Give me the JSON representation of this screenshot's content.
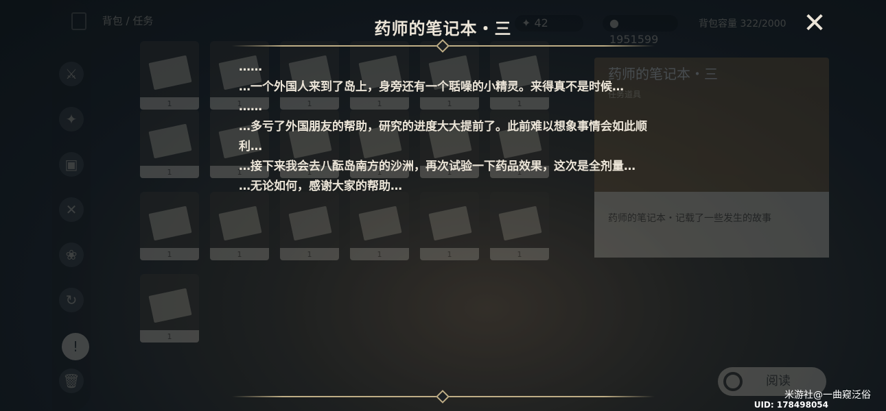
{
  "background": {
    "breadcrumb": "背包 / 任务",
    "primogems": "42",
    "mora": "1951599",
    "capacity": "背包容量 322/2000",
    "item_count": "1",
    "detail_title": "药师的笔记本・三",
    "detail_type": "任务道具",
    "detail_desc": "药师的笔记本・记载了一些发生的故事",
    "read_button": "阅读"
  },
  "note": {
    "title": "药师的笔记本・三",
    "lines": [
      "……",
      "…一个外国人来到了岛上，身旁还有一个聒噪的小精灵。来得真不是时候…",
      "……",
      "…多亏了外国朋友的帮助，研究的进度大大提前了。此前难以想象事情会如此顺利…",
      "…接下来我会去八酝岛南方的沙洲，再次试验一下药品效果，这次是全剂量…",
      "…无论如何，感谢大家的帮助…"
    ]
  },
  "close_icon": "close-icon",
  "watermark": "米游社@一曲窥泛俗",
  "uid": "UID: 178498054",
  "colors": {
    "text": "#ece5d8",
    "gold_line": "#bfae86",
    "panel": "#7a5f3a"
  }
}
